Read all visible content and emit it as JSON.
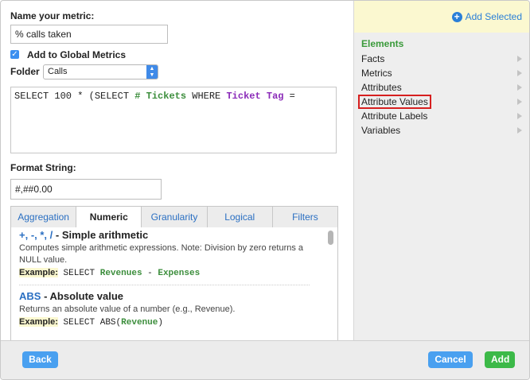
{
  "form": {
    "name_label": "Name your metric:",
    "name_value": "% calls taken",
    "global_label": "Add to Global Metrics",
    "folder_label": "Folder",
    "folder_value": "Calls",
    "format_label": "Format String:",
    "format_value": "#,##0.00"
  },
  "editor": {
    "part1": "SELECT 100 * (SELECT ",
    "metric": "# Tickets",
    "part2": " WHERE ",
    "attribute": "Ticket Tag",
    "part3": " ="
  },
  "tabs": [
    "Aggregation",
    "Numeric",
    "Granularity",
    "Logical",
    "Filters"
  ],
  "active_tab": "Numeric",
  "docs": [
    {
      "title_link": "+, -, *, /",
      "title_rest": " - Simple arithmetic",
      "desc": "Computes simple arithmetic expressions. Note: Division by zero returns a NULL value.",
      "example_label": "Example:",
      "example_prefix": " SELECT ",
      "example_a": "Revenues",
      "example_op": " - ",
      "example_b": "Expenses",
      "example_suffix": ""
    },
    {
      "title_link": "ABS",
      "title_rest": " - Absolute value",
      "desc": "Returns an absolute value of a number (e.g., Revenue).",
      "example_label": "Example:",
      "example_prefix": " SELECT ABS(",
      "example_a": "Revenue",
      "example_suffix": ")"
    }
  ],
  "sidebar": {
    "add_selected": "Add Selected",
    "elements_title": "Elements",
    "items": [
      {
        "label": "Facts"
      },
      {
        "label": "Metrics"
      },
      {
        "label": "Attributes"
      },
      {
        "label": "Attribute Values"
      },
      {
        "label": "Attribute Labels"
      },
      {
        "label": "Variables"
      }
    ]
  },
  "footer": {
    "back": "Back",
    "cancel": "Cancel",
    "add": "Add"
  },
  "colors": {
    "accent_blue": "#49a0f0",
    "add_green": "#3cb948",
    "metric_green": "#3b8d3b",
    "attribute_purple": "#8a2ab8",
    "highlight_red": "#d61f1f"
  }
}
